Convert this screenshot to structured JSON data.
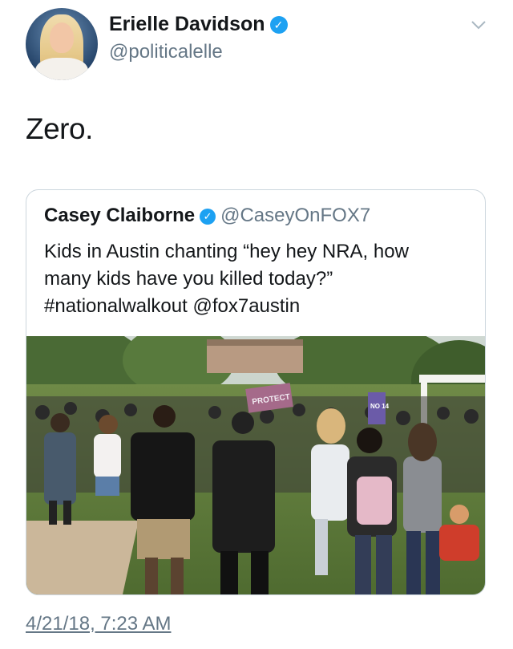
{
  "author": {
    "name": "Erielle Davidson",
    "handle": "@politicalelle",
    "verified": true
  },
  "tweet": {
    "text": "Zero.",
    "timestamp": "4/21/18, 7:23 AM"
  },
  "quoted_tweet": {
    "name": "Casey Claiborne",
    "handle": "@CaseyOnFOX7",
    "verified": true,
    "text_lines": [
      "Kids in Austin chanting “hey hey NRA, how",
      "many kids have you killed today?”",
      "#nationalwalkout @fox7austin"
    ],
    "media": {
      "description": "video still",
      "sign_text_left": "PROTECT",
      "sign_text_right": "NO 14"
    }
  },
  "icons": {
    "verified": "verified-badge-icon",
    "more": "chevron-down-icon"
  },
  "colors": {
    "verified_blue": "#1da1f2",
    "secondary_text": "#657786",
    "border": "#ccd6dd"
  }
}
